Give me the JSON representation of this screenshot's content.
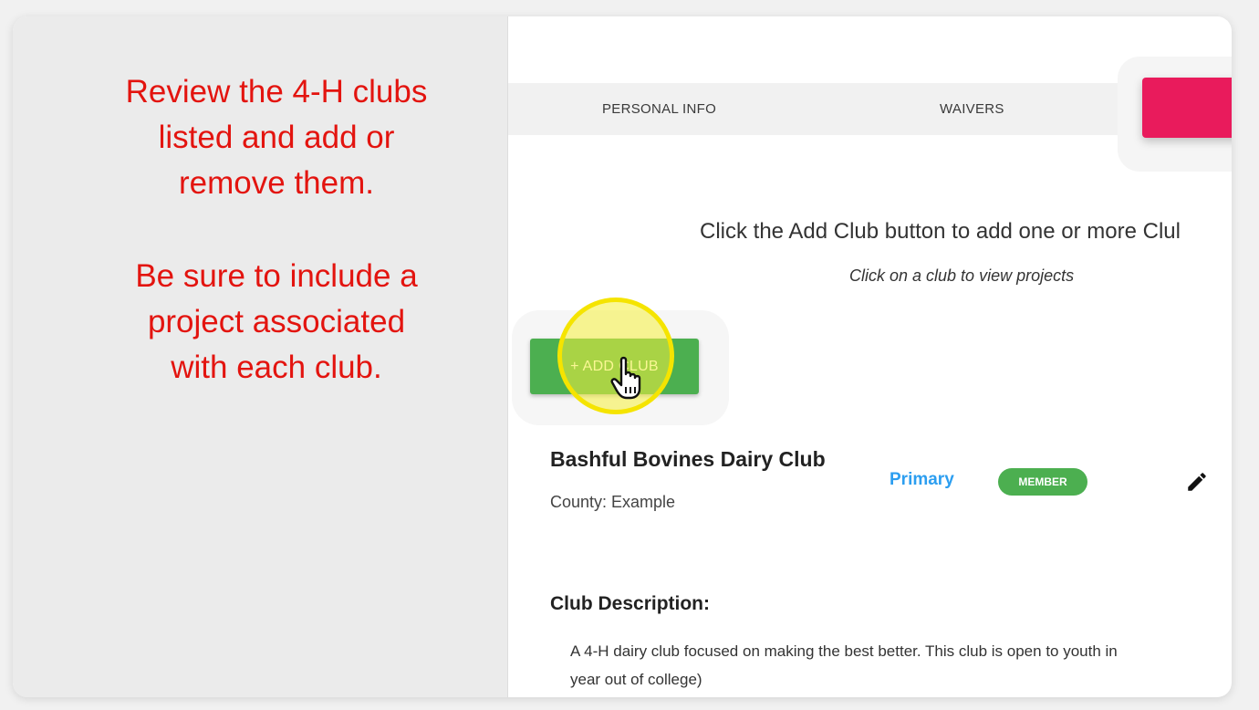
{
  "instructions": {
    "line1": "Review the 4-H clubs",
    "line2": "listed and add or",
    "line3": "remove them.",
    "line4": "Be sure to include a",
    "line5": "project associated",
    "line6": "with each club.",
    "color": "#e3140f"
  },
  "tabs": {
    "personal_info": "PERSONAL INFO",
    "waivers": "WAIVERS",
    "active_color": "#e91b5c"
  },
  "clubs_page": {
    "hint": "Click the Add Club button to add one or more Clul",
    "subhint": "Click on a club to view projects",
    "add_button_label": "+ ADD CLUB",
    "add_button_color": "#4caf50"
  },
  "club": {
    "name": "Bashful Bovines Dairy Club",
    "county": "County: Example",
    "primary_label": "Primary",
    "badge": "MEMBER",
    "description_heading": "Club Description:",
    "description_line1": "A 4-H dairy club focused on making the best better. This club is open to youth in",
    "description_line2": "year out of college)"
  },
  "icons": {
    "cursor": "hand-pointer-icon",
    "edit": "pencil-icon"
  }
}
